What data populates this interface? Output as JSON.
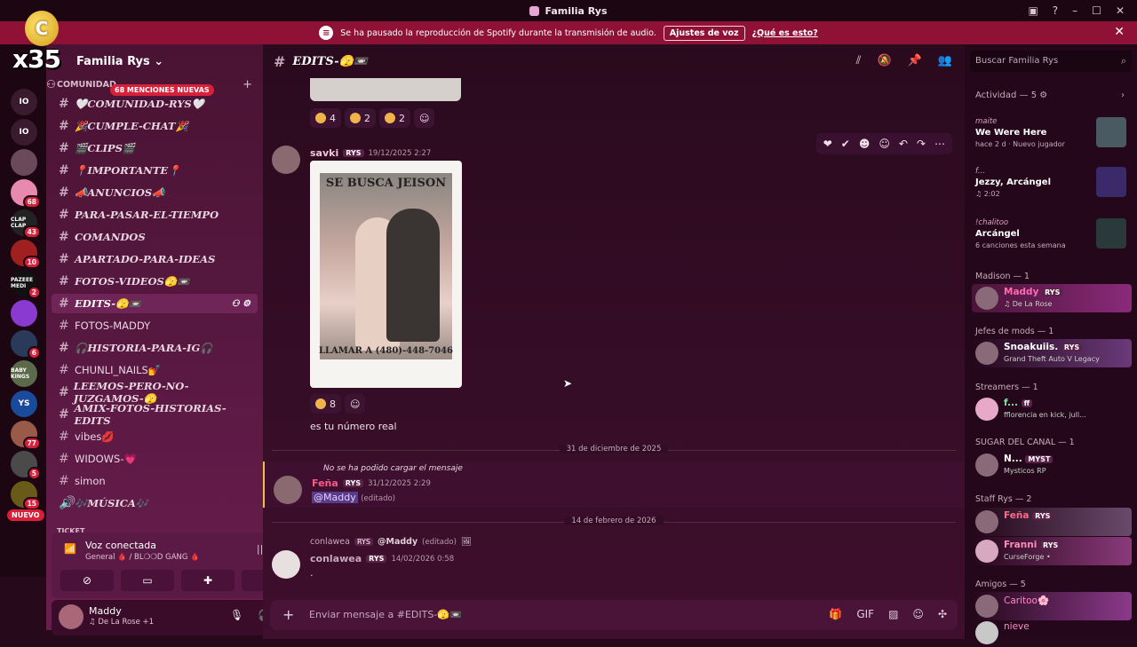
{
  "window": {
    "title": "Familia Rys"
  },
  "banner": {
    "text": "Se ha pausado la reproducción de Spotify durante la transmisión de audio.",
    "button": "Ajustes de voz",
    "link": "¿Qué es esto?"
  },
  "overlay": {
    "x35": "x35",
    "nuevo": "NUEVO"
  },
  "servers": [
    {
      "label": "IO",
      "badge": ""
    },
    {
      "label": "",
      "badge": "68"
    },
    {
      "label": "CLAP CLAP",
      "badge": "43"
    },
    {
      "label": "",
      "badge": "10"
    },
    {
      "label": "PAZEEE MEDI",
      "badge": "2"
    },
    {
      "label": "",
      "badge": ""
    },
    {
      "label": "",
      "badge": "6"
    },
    {
      "label": "BABY KINGS",
      "badge": ""
    },
    {
      "label": "YS",
      "badge": ""
    },
    {
      "label": "",
      "badge": "77"
    },
    {
      "label": "",
      "badge": "5"
    },
    {
      "label": "",
      "badge": "15"
    }
  ],
  "sidebar": {
    "server_name": "Familia Rys",
    "category": "COMUNIDAD",
    "mentions_badge": "68 MENCIONES NUEVAS",
    "channels": [
      {
        "name": "🤍COMUNIDAD-RYS🤍",
        "style": "it"
      },
      {
        "name": "🎉CUMPLE-CHAT🎉",
        "style": "it"
      },
      {
        "name": "🎬CLIPS🎬",
        "style": "it"
      },
      {
        "name": "📍IMPORTANTE📍",
        "style": "it"
      },
      {
        "name": "📣ANUNCIOS📣",
        "style": "it"
      },
      {
        "name": "PARA-PASAR-EL-TIEMPO",
        "style": "it"
      },
      {
        "name": "COMANDOS",
        "style": "it"
      },
      {
        "name": "APARTADO-PARA-IDEAS",
        "style": "it"
      },
      {
        "name": "FOTOS-VIDEOS🫣📼",
        "style": "it"
      },
      {
        "name": "EDITS-🫣📼",
        "style": "it"
      },
      {
        "name": "FOTOS-MADDY",
        "style": ""
      },
      {
        "name": "🎧HISTORIA-PARA-IG🎧",
        "style": "it"
      },
      {
        "name": "CHUNLI_NAILS💅",
        "style": ""
      },
      {
        "name": "LEEMOS-PERO-NO-JUZGAMOS-🫣",
        "style": "it"
      },
      {
        "name": "AMIX-FOTOS-HISTORIAS-EDITS",
        "style": "it"
      },
      {
        "name": "vibes💋",
        "style": ""
      },
      {
        "name": "WIDOWS-💗",
        "style": ""
      },
      {
        "name": "simon",
        "style": ""
      },
      {
        "name": "🎶MÚSICA🎶",
        "style": "it"
      }
    ],
    "ticket_category": "TICKET",
    "voice": {
      "title": "Voz conectada",
      "sub": "General 🩸 / BL❍❍D GANG 🩸"
    },
    "user": {
      "name": "Maddy",
      "status": "♫ De La Rose +1"
    }
  },
  "channel": {
    "name": "EDITS-🫣📼",
    "top_reactions": [
      {
        "count": "4"
      },
      {
        "count": "2"
      },
      {
        "count": "2"
      }
    ],
    "msg1": {
      "author": "savki",
      "tag": "RYS",
      "date": "19/12/2025 2:27",
      "poster_head": "SE BUSCA JEISON",
      "poster_foot": "LLAMAR A (480)-448-7046",
      "reaction": "8",
      "text": "es tu número real"
    },
    "divider1": "31 de diciembre de 2025",
    "reply_note": "No se ha podido cargar el mensaje",
    "msg2": {
      "author": "Feña",
      "tag": "RYS",
      "date": "31/12/2025 2:29",
      "mention": "@Maddy",
      "edited": "(editado)"
    },
    "divider2": "14 de febrero de 2026",
    "msg3": {
      "reply_author": "conlawea",
      "reply_tag": "RYS",
      "reply_text": "@Maddy",
      "reply_edited": "(editado)",
      "author": "conlawea",
      "tag": "RYS",
      "date": "14/02/2026 0:58",
      "text": "."
    },
    "input_placeholder": "Enviar mensaje a #EDITS-🫣📼"
  },
  "members": {
    "search_placeholder": "Buscar Familia Rys",
    "activity_header": "Actividad — 5",
    "activities": [
      {
        "user": "maite",
        "title": "We Were Here",
        "sub": "hace 2 d · Nuevo jugador"
      },
      {
        "user": "f...",
        "title": "Jezzy, Arcángel",
        "sub": "♫ 2:02"
      },
      {
        "user": "!chalitoo",
        "title": "Arcángel",
        "sub": "6 canciones esta semana"
      }
    ],
    "groups": [
      {
        "header": "Madison — 1",
        "items": [
          {
            "name": "Maddy",
            "tag": "RYS",
            "sub": "♫ De La Rose"
          }
        ]
      },
      {
        "header": "Jefes de mods — 1",
        "items": [
          {
            "name": "Snoakuiis.",
            "tag": "RYS",
            "sub": "Grand Theft Auto V Legacy"
          }
        ]
      },
      {
        "header": "Streamers — 1",
        "items": [
          {
            "name": "f...",
            "tag": "ff",
            "sub": "fflorencia en kick, jull..."
          }
        ]
      },
      {
        "header": "SUGAR DEL CANAL — 1",
        "items": [
          {
            "name": "N...",
            "tag": "MYST",
            "sub": "Mysticos RP"
          }
        ]
      },
      {
        "header": "Staff Rys — 2",
        "items": [
          {
            "name": "Feña",
            "tag": "RYS",
            "sub": ""
          },
          {
            "name": "Franni",
            "tag": "RYS",
            "sub": "CurseForge •"
          }
        ]
      },
      {
        "header": "Amigos — 5",
        "items": [
          {
            "name": "Caritoo🌸",
            "tag": "",
            "sub": ""
          },
          {
            "name": "nieve",
            "tag": "",
            "sub": ""
          }
        ]
      }
    ]
  },
  "colors": {
    "banner": "#8f1136",
    "badge": "#d8203a",
    "accent": "#f0c8dc"
  }
}
